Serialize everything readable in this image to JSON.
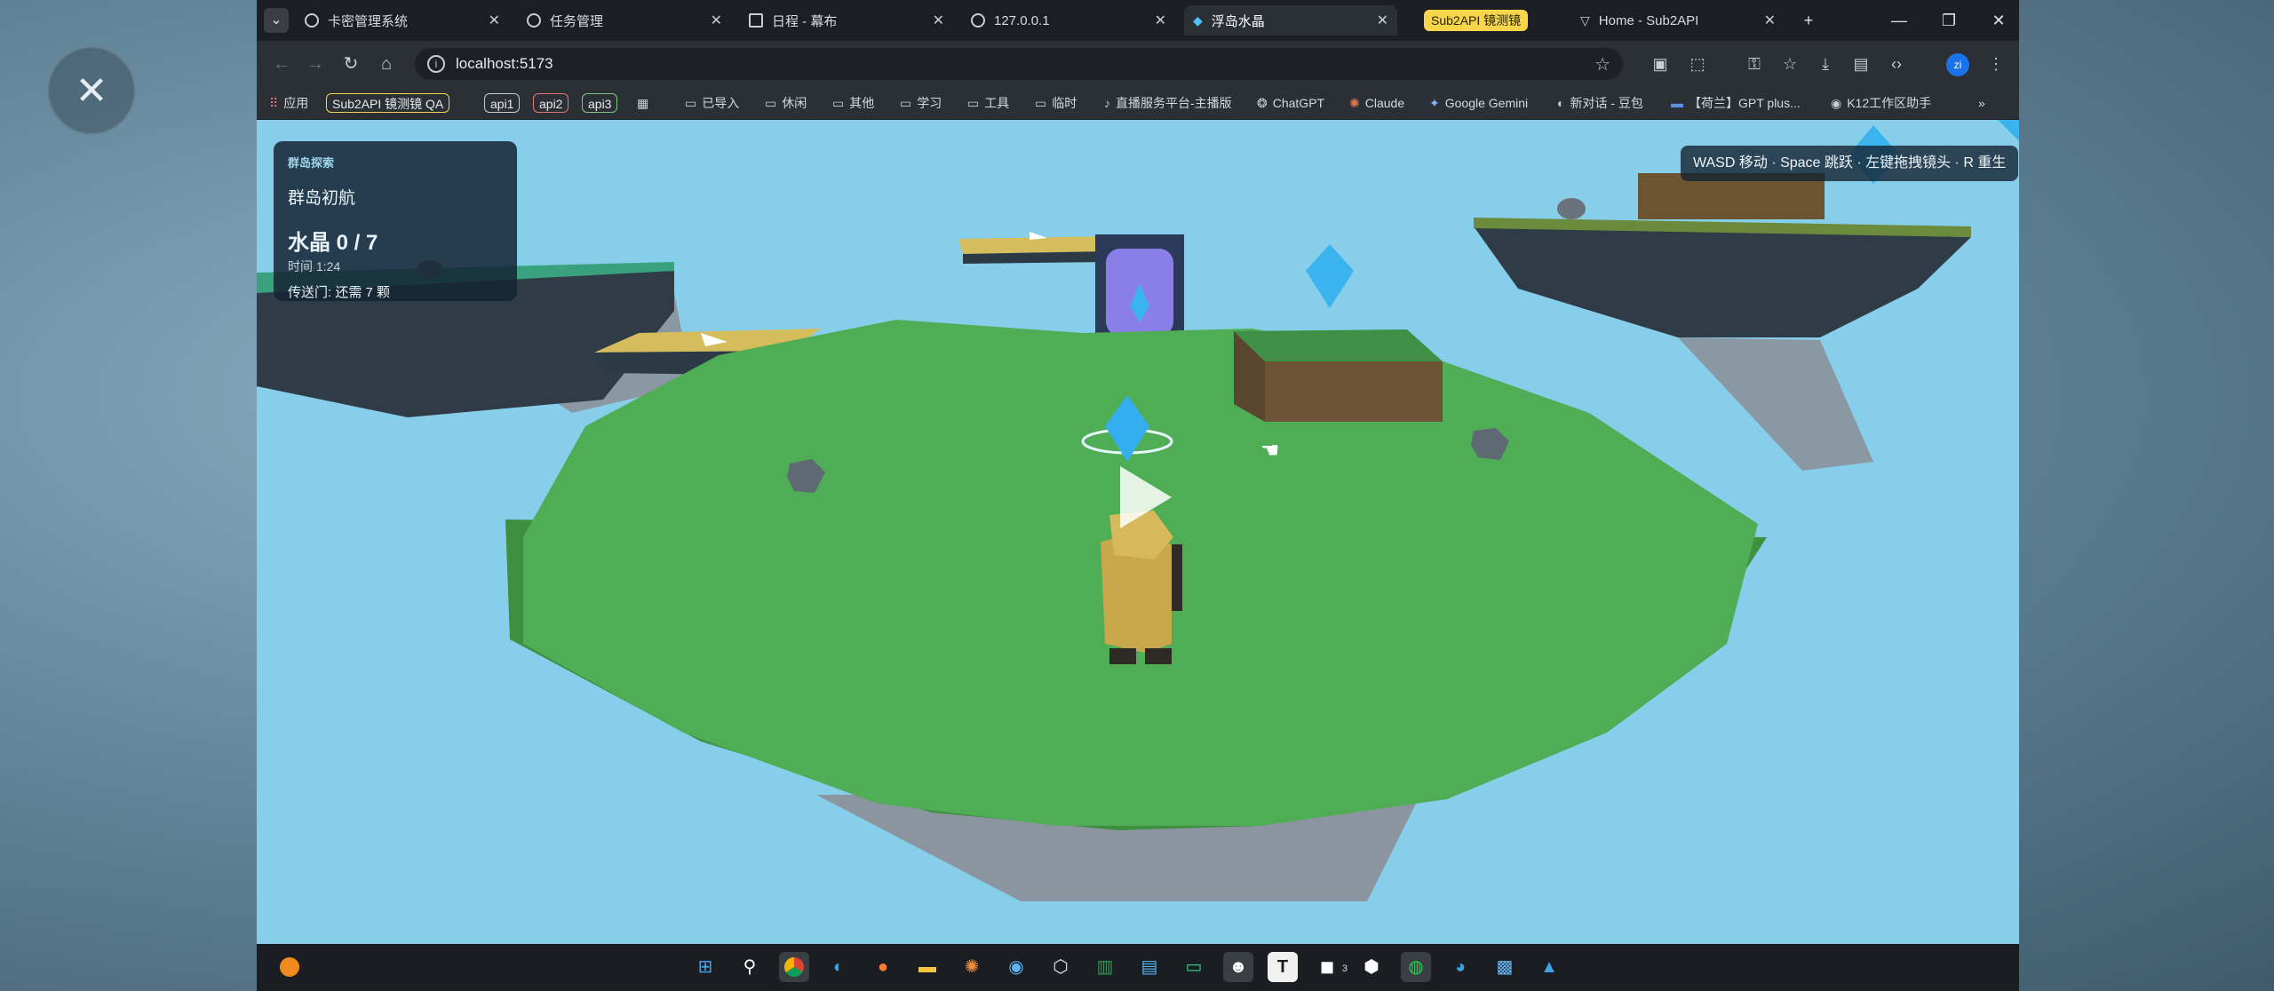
{
  "browser": {
    "tabs": [
      {
        "label": "卡密管理系统",
        "icon": "globe-icon"
      },
      {
        "label": "任务管理",
        "icon": "globe-icon"
      },
      {
        "label": "日程 - 幕布",
        "icon": "grid-icon"
      },
      {
        "label": "127.0.0.1",
        "icon": "globe-icon"
      },
      {
        "label": "浮岛水晶",
        "icon": "crystal-icon",
        "active": true
      },
      {
        "label": "Home - Sub2API",
        "icon": "triangle-icon"
      }
    ],
    "tab_group_label": "Sub2API 镜测镜",
    "address": "localhost:5173",
    "bookmarks": [
      {
        "label": "应用",
        "icon": "apps-icon"
      },
      {
        "label": "已导入",
        "icon": "folder-icon"
      },
      {
        "label": "休闲",
        "icon": "folder-icon"
      },
      {
        "label": "其他",
        "icon": "folder-icon"
      },
      {
        "label": "学习",
        "icon": "folder-icon"
      },
      {
        "label": "工具",
        "icon": "folder-icon"
      },
      {
        "label": "临时",
        "icon": "folder-icon"
      },
      {
        "label": "直播服务平台-主播版",
        "icon": "tiktok-icon"
      },
      {
        "label": "ChatGPT",
        "icon": "chatgpt-icon"
      },
      {
        "label": "Claude",
        "icon": "claude-icon"
      },
      {
        "label": "Google Gemini",
        "icon": "gemini-icon"
      },
      {
        "label": "新对话 - 豆包",
        "icon": "doubao-icon"
      },
      {
        "label": "【荷兰】GPT plus...",
        "icon": "flag-icon"
      },
      {
        "label": "K12工作区助手",
        "icon": "globe-icon"
      }
    ],
    "chips": [
      {
        "label": "Sub2API 镜测镜 QA",
        "color": "#f6d54a"
      },
      {
        "label": "api1",
        "color": "#c9ced4"
      },
      {
        "label": "api2",
        "color": "#e57373"
      },
      {
        "label": "api3",
        "color": "#81c784"
      }
    ],
    "more": "»",
    "avatar_initials": "zi"
  },
  "game": {
    "hud": {
      "tag": "群岛探索",
      "level_name": "群岛初航",
      "crystals": "水晶 0 / 7",
      "time": "时间 1:24",
      "portal": "传送门: 还需 7 颗"
    },
    "controls_help": "WASD 移动 · Space 跳跃 · 左键拖拽镜头 · R 重生",
    "colors": {
      "sky": "#87ceeb",
      "grass": "#4caf50",
      "crystal": "#29b6f6",
      "player": "#c8a84a",
      "rock": "#5f6973"
    }
  },
  "taskbar": {
    "wechat_badge": "3"
  }
}
